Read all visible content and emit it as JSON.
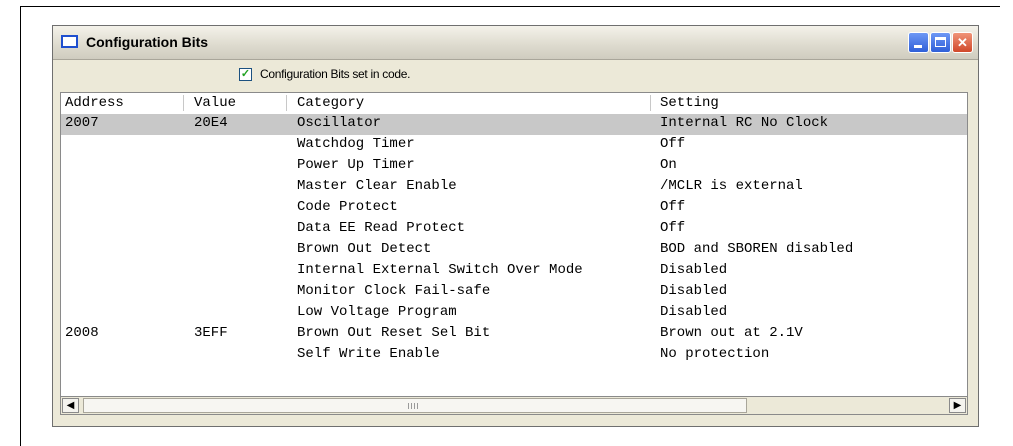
{
  "window": {
    "title": "Configuration Bits"
  },
  "checkbox": {
    "label": "Configuration Bits set in code.",
    "checked": true
  },
  "columns": [
    "Address",
    "Value",
    "Category",
    "Setting"
  ],
  "rows": [
    {
      "address": "2007",
      "value": "20E4",
      "category": "Oscillator",
      "setting": "Internal RC No Clock"
    },
    {
      "address": "",
      "value": "",
      "category": "Watchdog Timer",
      "setting": "Off"
    },
    {
      "address": "",
      "value": "",
      "category": "Power Up Timer",
      "setting": "On"
    },
    {
      "address": "",
      "value": "",
      "category": "Master Clear Enable",
      "setting": "/MCLR is external"
    },
    {
      "address": "",
      "value": "",
      "category": "Code Protect",
      "setting": "Off"
    },
    {
      "address": "",
      "value": "",
      "category": "Data EE Read Protect",
      "setting": "Off"
    },
    {
      "address": "",
      "value": "",
      "category": "Brown Out Detect",
      "setting": "BOD and SBOREN disabled"
    },
    {
      "address": "",
      "value": "",
      "category": "Internal External Switch Over Mode",
      "setting": "Disabled"
    },
    {
      "address": "",
      "value": "",
      "category": "Monitor Clock Fail-safe",
      "setting": "Disabled"
    },
    {
      "address": "",
      "value": "",
      "category": "Low Voltage Program",
      "setting": "Disabled"
    },
    {
      "address": "2008",
      "value": "3EFF",
      "category": "Brown Out Reset Sel Bit",
      "setting": "Brown out at 2.1V"
    },
    {
      "address": "",
      "value": "",
      "category": "Self Write Enable",
      "setting": "No protection"
    }
  ]
}
